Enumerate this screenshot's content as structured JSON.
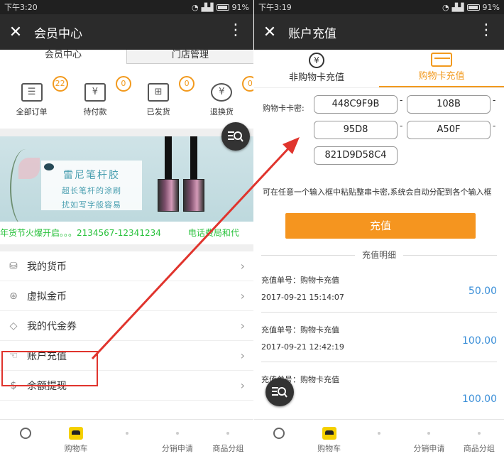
{
  "left": {
    "status_time": "下午3:20",
    "battery": "91%",
    "title": "会员中心",
    "tabs": [
      "会员中心",
      "门店管理"
    ],
    "orders": [
      {
        "label": "全部订单",
        "badge": "22",
        "icon": "receipt-icon"
      },
      {
        "label": "待付款",
        "badge": "0",
        "icon": "yen-wallet-icon"
      },
      {
        "label": "已发货",
        "badge": "0",
        "icon": "box-icon"
      },
      {
        "label": "退换货",
        "badge": "0",
        "icon": "yen-return-icon"
      }
    ],
    "banner": {
      "title": "雷尼笔杆胶",
      "line1": "超长笔杆的涂刷",
      "line2": "扰如写字般容易",
      "ticker_a": "年货节火爆开启。。。2134567-12341234",
      "ticker_b": "电话费局和代"
    },
    "menu": [
      {
        "label": "我的货币",
        "icon": "coins-icon"
      },
      {
        "label": "虚拟金币",
        "icon": "yen-coin-icon"
      },
      {
        "label": "我的代金券",
        "icon": "tag-icon"
      },
      {
        "label": "账户充值",
        "icon": "hand-card-icon"
      },
      {
        "label": "余额提现",
        "icon": "money-bag-icon"
      }
    ],
    "tabbar": [
      "",
      "购物车",
      "",
      "分销申请",
      "商品分组"
    ]
  },
  "right": {
    "status_time": "下午3:19",
    "battery": "91%",
    "title": "账户充值",
    "tabs": [
      "非购物卡充值",
      "购物卡充值"
    ],
    "card_label": "购物卡卡密:",
    "fields": [
      "448C9F9B",
      "108B",
      "95D8",
      "A50F",
      "821D9D58C4"
    ],
    "hint": "可在任意一个输入框中粘贴整串卡密,系统会自动分配到各个输入框",
    "button": "充值",
    "section": "充值明细",
    "records": [
      {
        "title": "充值单号：购物卡充值",
        "time": "2017-09-21 15:14:07",
        "amount": "50.00"
      },
      {
        "title": "充值单号：购物卡充值",
        "time": "2017-09-21 12:42:19",
        "amount": "100.00"
      },
      {
        "title": "充值单号：购物卡充值",
        "time": "",
        "amount": "100.00"
      }
    ],
    "tabbar": [
      "",
      "购物车",
      "",
      "分销申请",
      "商品分组"
    ]
  },
  "colors": {
    "accent": "#f5951f",
    "link_amount": "#3b8fd8",
    "ticker": "#27c13a",
    "highlight": "#e0342d"
  }
}
